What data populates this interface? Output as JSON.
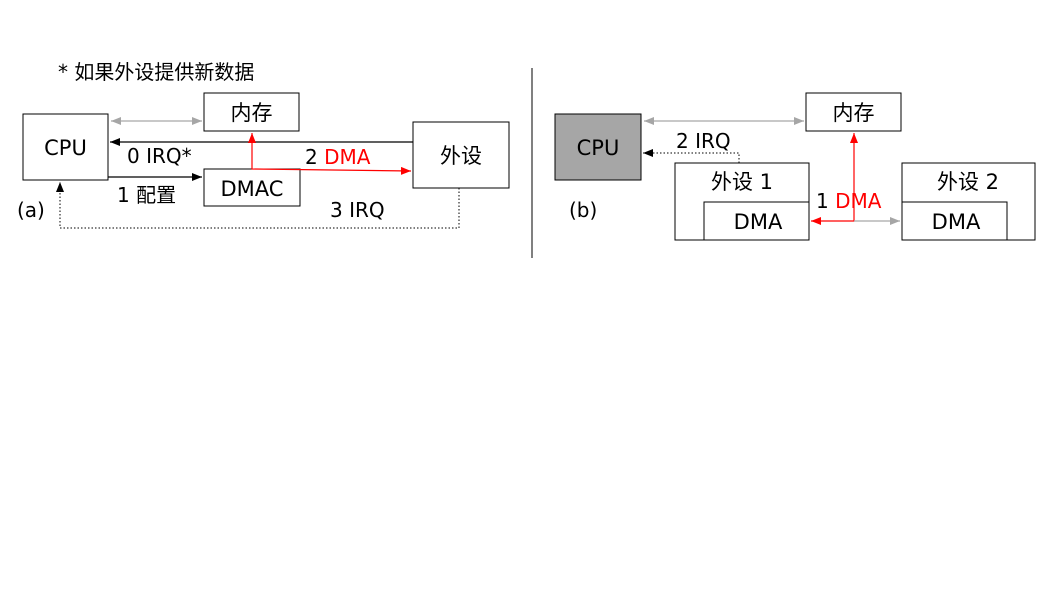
{
  "note": "*  如果外设提供新数据",
  "colors": {
    "dma": "#ff0000",
    "gray_arrow": "#a6a6a6",
    "cpu_b_fill": "#a6a6a6",
    "black": "#000000"
  },
  "diagram_a": {
    "label": "(a)",
    "cpu": "CPU",
    "memory": "内存",
    "dmac": "DMAC",
    "peripheral": "外设",
    "irq0": "0 IRQ*",
    "config": "1  配置",
    "dma_num": "2 ",
    "dma_text": "DMA",
    "irq3": "3 IRQ"
  },
  "diagram_b": {
    "label": "(b)",
    "cpu": "CPU",
    "memory": "内存",
    "peripheral1": "外设  1",
    "peripheral2": "外设  2",
    "dma1": "DMA",
    "dma2": "DMA",
    "irq2": "2 IRQ",
    "dma_num": "1 ",
    "dma_text": "DMA"
  }
}
